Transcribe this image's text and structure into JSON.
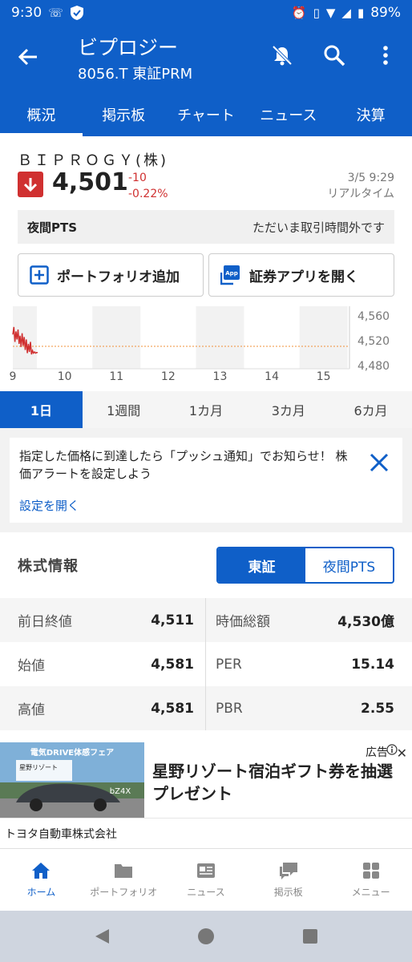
{
  "status_bar": {
    "time": "9:30",
    "battery": "89%"
  },
  "app_bar": {
    "title": "ビプロジー",
    "subtitle": "8056.T 東証PRM"
  },
  "tabs": [
    "概況",
    "掲示板",
    "チャート",
    "ニュース",
    "決算"
  ],
  "quote": {
    "company": "ＢＩＰＲＯＧＹ(株)",
    "price": "4,501",
    "change": "-10",
    "change_pct": "-0.22%",
    "datetime": "3/5 9:29",
    "realtime": "リアルタイム",
    "pts_label": "夜間PTS",
    "pts_status": "ただいま取引時間外です",
    "portfolio_btn": "ポートフォリオ追加",
    "app_btn": "証券アプリを開く"
  },
  "chart_data": {
    "type": "line",
    "y_ticks": [
      "4,560",
      "4,520",
      "4,480"
    ],
    "x_ticks": [
      "9",
      "10",
      "11",
      "12",
      "13",
      "14",
      "15"
    ],
    "ylim": [
      4480,
      4560
    ],
    "reference_line": 4511,
    "x": [
      9.0,
      9.02,
      9.04,
      9.06,
      9.08,
      9.1,
      9.12,
      9.14,
      9.16,
      9.18,
      9.2,
      9.22,
      9.24,
      9.26,
      9.28,
      9.3,
      9.32,
      9.34,
      9.36,
      9.38,
      9.4,
      9.42,
      9.44,
      9.46,
      9.48
    ],
    "values": [
      4530,
      4542,
      4518,
      4535,
      4522,
      4538,
      4515,
      4528,
      4510,
      4532,
      4512,
      4526,
      4505,
      4522,
      4500,
      4515,
      4502,
      4518,
      4498,
      4504,
      4500,
      4502,
      4500,
      4501,
      4501
    ]
  },
  "periods": [
    "1日",
    "1週間",
    "1カ月",
    "3カ月",
    "6カ月"
  ],
  "alert": {
    "text": "指定した価格に到達したら「プッシュ通知」でお知らせ！ 株価アラートを設定しよう",
    "link": "設定を開く"
  },
  "stock_info": {
    "heading": "株式情報",
    "segments": [
      "東証",
      "夜間PTS"
    ],
    "rows": [
      {
        "k1": "前日終値",
        "v1": "4,511",
        "k2": "時価総額",
        "v2": "4,530億"
      },
      {
        "k1": "始値",
        "v1": "4,581",
        "k2": "PER",
        "v2": "15.14"
      },
      {
        "k1": "高値",
        "v1": "4,581",
        "k2": "PBR",
        "v2": "2.55"
      }
    ]
  },
  "ad": {
    "label": "広告",
    "headline": "星野リゾート宿泊ギフト券を抽選プレゼント",
    "advertiser": "トヨタ自動車株式会社",
    "image_text_1": "電気DRIVE体感フェア",
    "image_text_2": "星野リゾート",
    "image_text_3": "bZ4X"
  },
  "bottom_nav": [
    "ホーム",
    "ポートフォリオ",
    "ニュース",
    "掲示板",
    "メニュー"
  ],
  "colors": {
    "brand": "#0f5fc8",
    "down": "#d03030"
  }
}
